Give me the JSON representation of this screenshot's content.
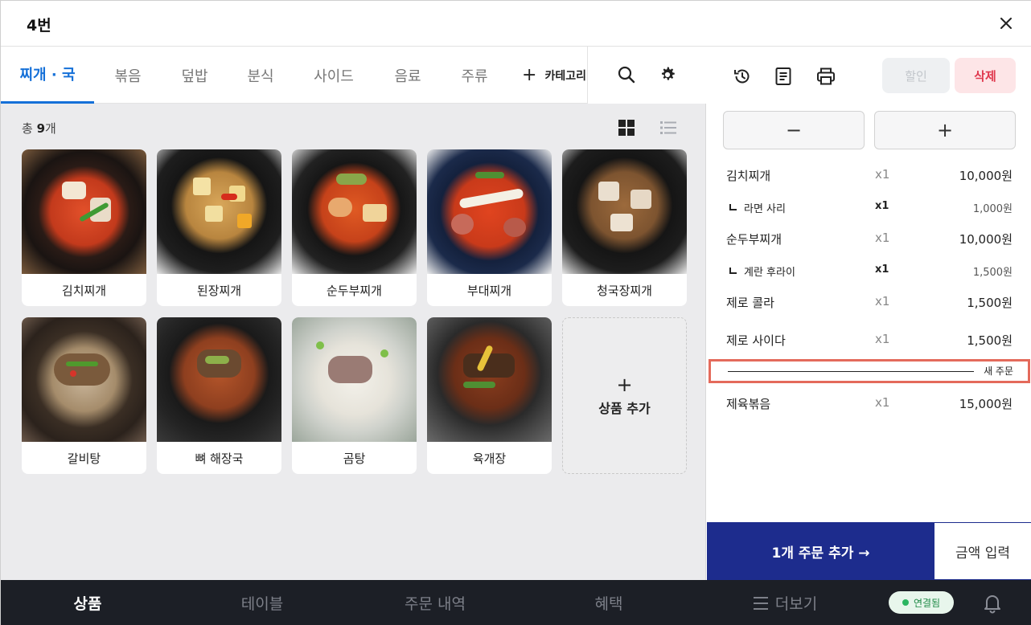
{
  "window": {
    "title": "4번",
    "close_label": "×"
  },
  "tabs": [
    {
      "label": "찌개 · 국",
      "active": true
    },
    {
      "label": "볶음"
    },
    {
      "label": "덮밥"
    },
    {
      "label": "분식"
    },
    {
      "label": "사이드"
    },
    {
      "label": "음료"
    },
    {
      "label": "주류"
    }
  ],
  "add_category": {
    "plus": "+",
    "label": "카테고리"
  },
  "product_count": {
    "prefix": "총 ",
    "count": "9",
    "suffix": "개"
  },
  "products": [
    {
      "name": "김치찌개",
      "image": "kimchi-stew"
    },
    {
      "name": "된장찌개",
      "image": "soybean-paste-stew"
    },
    {
      "name": "순두부찌개",
      "image": "soft-tofu-stew"
    },
    {
      "name": "부대찌개",
      "image": "army-stew"
    },
    {
      "name": "청국장찌개",
      "image": "fermented-soybean-stew"
    },
    {
      "name": "갈비탕",
      "image": "short-rib-soup"
    },
    {
      "name": "뼈 해장국",
      "image": "pork-bone-soup"
    },
    {
      "name": "곰탕",
      "image": "beef-bone-soup"
    },
    {
      "name": "육개장",
      "image": "spicy-beef-soup"
    }
  ],
  "add_product": {
    "plus": "+",
    "label": "상품 추가"
  },
  "order_actions": {
    "discount": "할인",
    "delete": "삭제",
    "minus": "−",
    "plus": "+"
  },
  "orders": [
    {
      "name": "김치찌개",
      "qty": "x1",
      "price": "10,000원"
    },
    {
      "name": "라면 사리",
      "qty": "x1",
      "price": "1,000원",
      "sub": true
    },
    {
      "name": "순두부찌개",
      "qty": "x1",
      "price": "10,000원"
    },
    {
      "name": "계란 후라이",
      "qty": "x1",
      "price": "1,500원",
      "sub": true
    },
    {
      "name": "제로 콜라",
      "qty": "x1",
      "price": "1,500원"
    },
    {
      "name": "제로 사이다",
      "qty": "x1",
      "price": "1,500원"
    }
  ],
  "new_order_divider": "새 주문",
  "new_orders": [
    {
      "name": "제육볶음",
      "qty": "x1",
      "price": "15,000원"
    }
  ],
  "footer_buttons": {
    "add_order": "1개 주문 추가 →",
    "amount_input": "금액 입력"
  },
  "bottom_nav": {
    "items": [
      {
        "label": "상품",
        "active": true
      },
      {
        "label": "테이블"
      },
      {
        "label": "주문 내역"
      },
      {
        "label": "혜택"
      },
      {
        "label": "더보기",
        "icon": "menu-icon"
      }
    ],
    "status": "연결됨",
    "bell_icon": "bell-icon"
  },
  "colors": {
    "accent": "#1570d8",
    "primary_button": "#1d2c8d",
    "delete": "#e0384e",
    "highlight_border": "#e46a5b",
    "nav_bg": "#1c1f26",
    "connected": "#2bb561"
  }
}
